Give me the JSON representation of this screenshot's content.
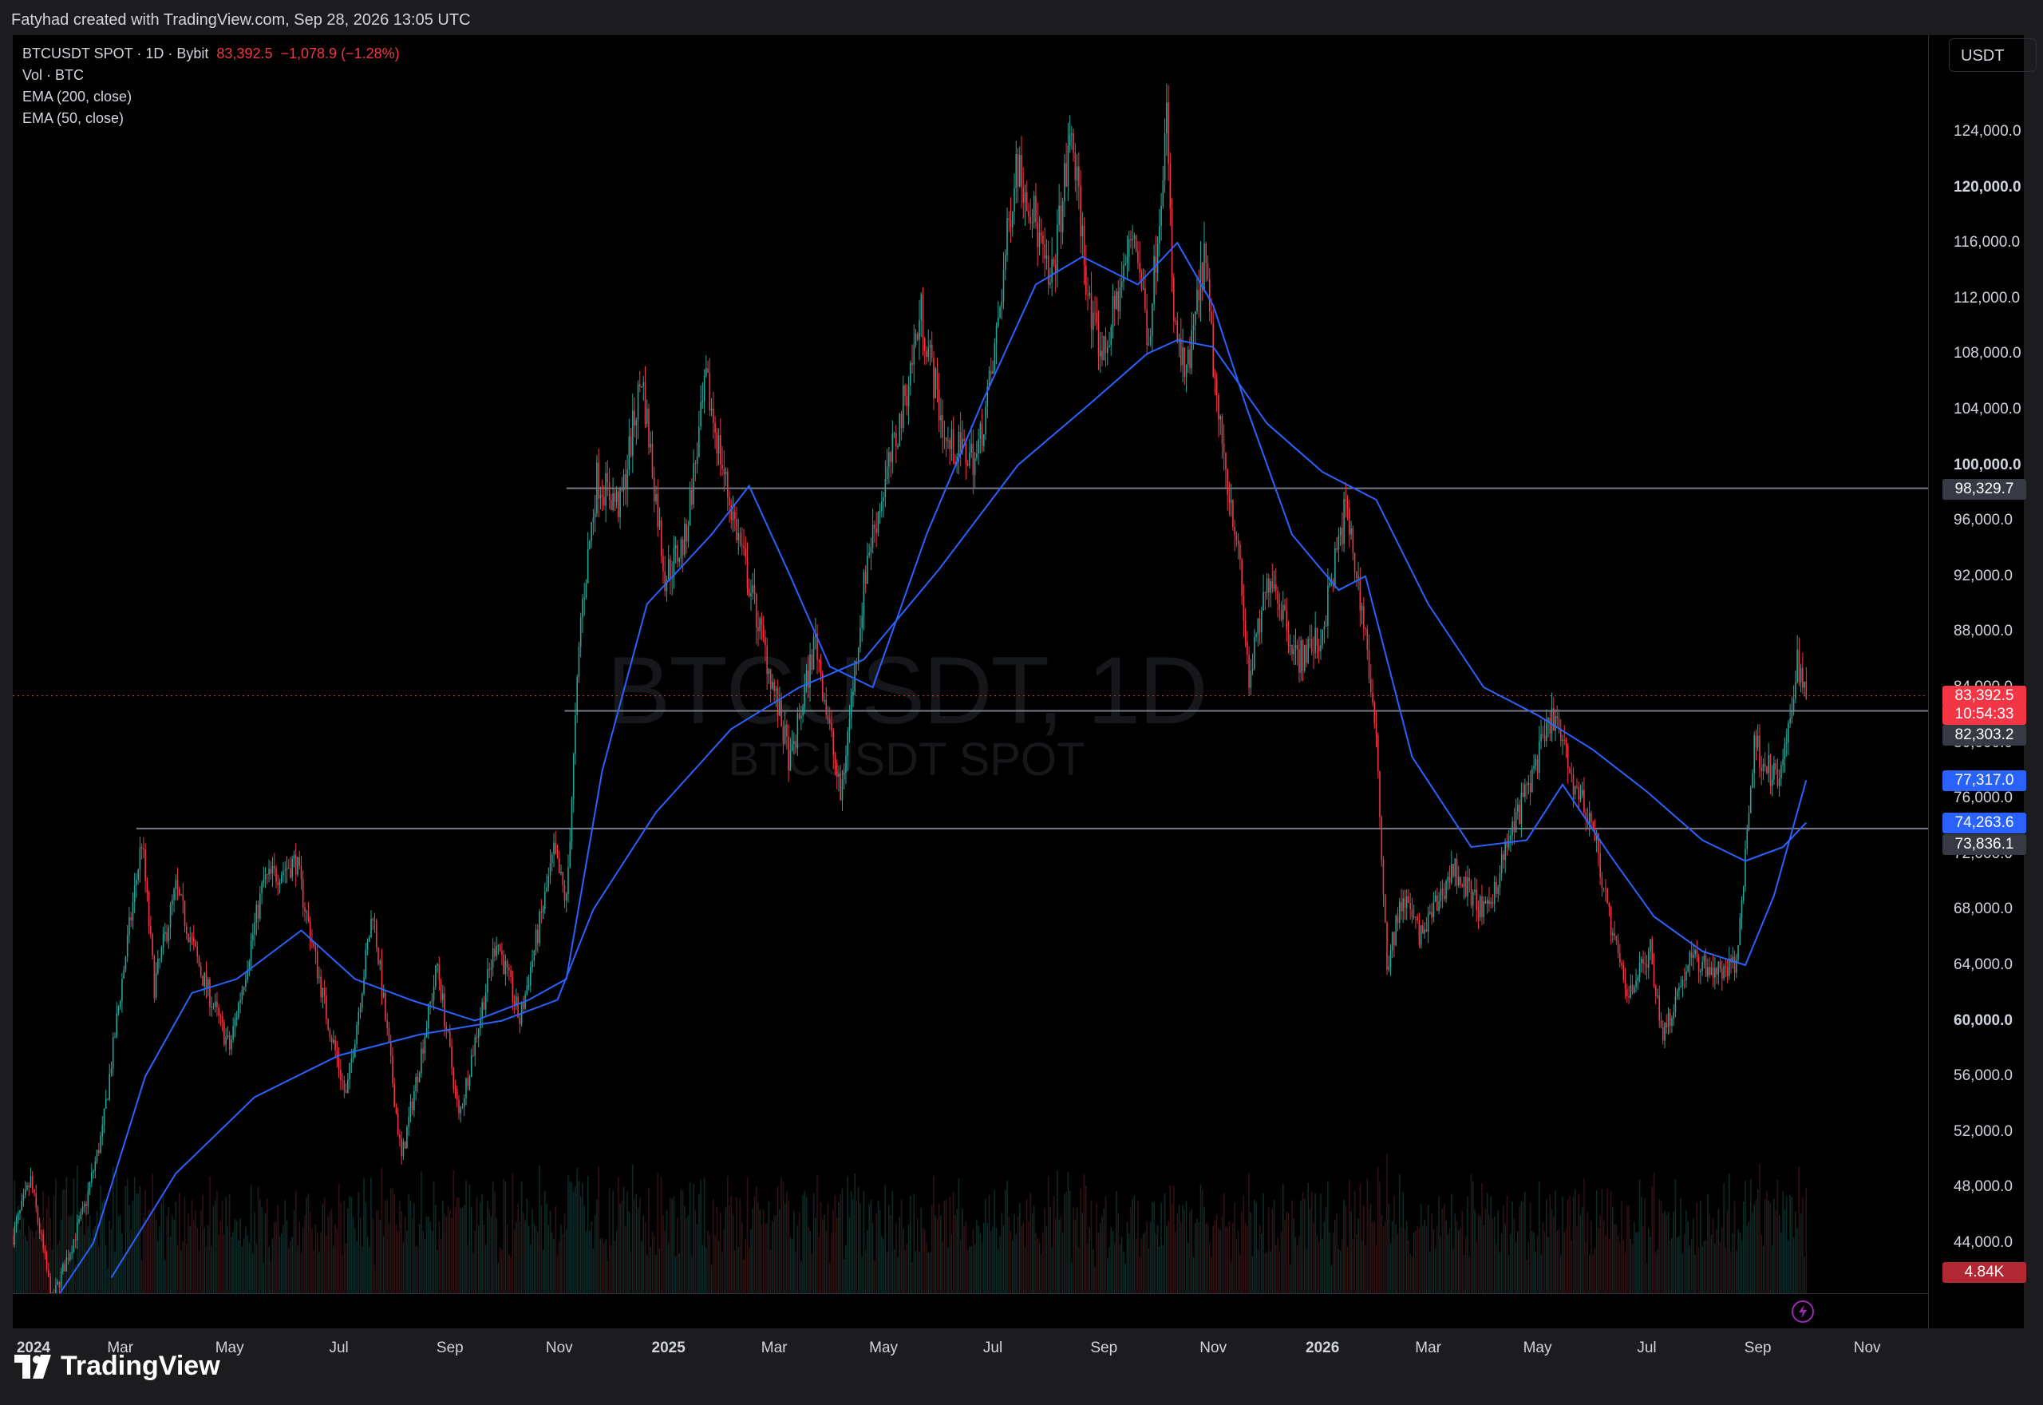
{
  "caption": "Fatyhad created with TradingView.com, Sep 28, 2026 13:05 UTC",
  "legend": {
    "symbol_line": "BTCUSDT SPOT · 1D · Bybit",
    "last": "83,392.5",
    "change": "−1,078.9 (−1.28%)",
    "vol": "Vol · BTC",
    "ema200": "EMA (200, close)",
    "ema50": "EMA (50, close)"
  },
  "unit_button": "USDT",
  "watermark": {
    "main": "BTCUSDT, 1D",
    "sub": "BTCUSDT SPOT"
  },
  "brand": "TradingView",
  "colors": {
    "up": "#26a69a",
    "down": "#f23645",
    "ema": "#2962ff",
    "hline": "#787b86",
    "last_price": "#f23645",
    "background": "#000000"
  },
  "price_labels": {
    "resistance": "98,329.7",
    "last_price": "83,392.5",
    "countdown": "10:54:33",
    "level_mid": "82,303.2",
    "ema50_value": "77,317.0",
    "ema200_value": "74,263.6",
    "level_low": "73,836.1",
    "volume_value": "4.84K"
  },
  "chart_data": {
    "type": "candlestick",
    "symbol": "BTCUSDT SPOT",
    "interval": "1D",
    "exchange": "Bybit",
    "y_axis": {
      "ticks": [
        "124,000.0",
        "120,000.0",
        "116,000.0",
        "112,000.0",
        "108,000.0",
        "104,000.0",
        "100,000.0",
        "96,000.0",
        "92,000.0",
        "88,000.0",
        "84,000.0",
        "80,000.0",
        "76,000.0",
        "72,000.0",
        "68,000.0",
        "64,000.0",
        "60,000.0",
        "56,000.0",
        "52,000.0",
        "48,000.0",
        "44,000.0"
      ],
      "ylim": [
        41500,
        130000
      ]
    },
    "x_axis": {
      "ticks": [
        "2024",
        "Mar",
        "May",
        "Jul",
        "Sep",
        "Nov",
        "2025",
        "Mar",
        "May",
        "Jul",
        "Sep",
        "Nov",
        "2026",
        "Mar",
        "May",
        "Jul",
        "Sep",
        "Nov"
      ]
    },
    "horizontal_lines": [
      98329.7,
      82303.2,
      73836.1
    ],
    "price_path": [
      [
        "2024-01-01",
        44500
      ],
      [
        "2024-01-11",
        48500
      ],
      [
        "2024-01-23",
        39800
      ],
      [
        "2024-02-10",
        46500
      ],
      [
        "2024-02-20",
        52000
      ],
      [
        "2024-03-01",
        62000
      ],
      [
        "2024-03-13",
        73000
      ],
      [
        "2024-03-20",
        62500
      ],
      [
        "2024-04-01",
        69500
      ],
      [
        "2024-04-15",
        63500
      ],
      [
        "2024-05-01",
        58000
      ],
      [
        "2024-05-20",
        70000
      ],
      [
        "2024-06-07",
        71500
      ],
      [
        "2024-06-24",
        60500
      ],
      [
        "2024-07-05",
        54500
      ],
      [
        "2024-07-20",
        68000
      ],
      [
        "2024-08-05",
        50000
      ],
      [
        "2024-08-25",
        64000
      ],
      [
        "2024-09-06",
        53000
      ],
      [
        "2024-09-27",
        66000
      ],
      [
        "2024-10-10",
        60000
      ],
      [
        "2024-10-29",
        72000
      ],
      [
        "2024-11-05",
        68500
      ],
      [
        "2024-11-13",
        89000
      ],
      [
        "2024-11-22",
        99000
      ],
      [
        "2024-12-05",
        97000
      ],
      [
        "2024-12-17",
        106500
      ],
      [
        "2024-12-30",
        92000
      ],
      [
        "2025-01-10",
        94500
      ],
      [
        "2025-01-22",
        106000
      ],
      [
        "2025-02-03",
        98000
      ],
      [
        "2025-02-25",
        86000
      ],
      [
        "2025-03-10",
        78500
      ],
      [
        "2025-03-24",
        87500
      ],
      [
        "2025-04-07",
        76000
      ],
      [
        "2025-04-22",
        93500
      ],
      [
        "2025-05-10",
        103000
      ],
      [
        "2025-05-22",
        111000
      ],
      [
        "2025-06-05",
        101500
      ],
      [
        "2025-06-22",
        100500
      ],
      [
        "2025-07-01",
        107000
      ],
      [
        "2025-07-14",
        122000
      ],
      [
        "2025-07-24",
        118000
      ],
      [
        "2025-08-02",
        112500
      ],
      [
        "2025-08-14",
        124000
      ],
      [
        "2025-08-25",
        110000
      ],
      [
        "2025-09-01",
        108000
      ],
      [
        "2025-09-18",
        117000
      ],
      [
        "2025-09-26",
        109000
      ],
      [
        "2025-10-06",
        125000
      ],
      [
        "2025-10-10",
        110000
      ],
      [
        "2025-10-17",
        106000
      ],
      [
        "2025-10-27",
        115000
      ],
      [
        "2025-11-04",
        103000
      ],
      [
        "2025-11-14",
        95000
      ],
      [
        "2025-11-21",
        84500
      ],
      [
        "2025-12-03",
        92500
      ],
      [
        "2025-12-18",
        86000
      ],
      [
        "2025-12-31",
        87500
      ],
      [
        "2026-01-14",
        97000
      ],
      [
        "2026-01-25",
        88000
      ],
      [
        "2026-02-01",
        78000
      ],
      [
        "2026-02-06",
        64000
      ],
      [
        "2026-02-15",
        69000
      ],
      [
        "2026-02-25",
        66000
      ],
      [
        "2026-03-15",
        71000
      ],
      [
        "2026-04-02",
        67500
      ],
      [
        "2026-04-15",
        73000
      ],
      [
        "2026-04-30",
        78500
      ],
      [
        "2026-05-10",
        82000
      ],
      [
        "2026-05-20",
        77500
      ],
      [
        "2026-06-01",
        74000
      ],
      [
        "2026-06-12",
        66000
      ],
      [
        "2026-06-20",
        62000
      ],
      [
        "2026-07-03",
        65000
      ],
      [
        "2026-07-10",
        59000
      ],
      [
        "2026-07-25",
        64500
      ],
      [
        "2026-08-10",
        63500
      ],
      [
        "2026-08-20",
        64000
      ],
      [
        "2026-08-30",
        80000
      ],
      [
        "2026-09-12",
        77000
      ],
      [
        "2026-09-18",
        80500
      ],
      [
        "2026-09-23",
        86000
      ],
      [
        "2026-09-28",
        83392.5
      ]
    ],
    "ema200_path": [
      [
        "2024-02-25",
        41500
      ],
      [
        "2024-04-01",
        49000
      ],
      [
        "2024-05-15",
        54500
      ],
      [
        "2024-07-01",
        57500
      ],
      [
        "2024-08-15",
        59000
      ],
      [
        "2024-09-30",
        60000
      ],
      [
        "2024-10-31",
        61500
      ],
      [
        "2024-11-20",
        68000
      ],
      [
        "2024-12-25",
        75000
      ],
      [
        "2025-02-05",
        81000
      ],
      [
        "2025-03-15",
        84000
      ],
      [
        "2025-04-20",
        86000
      ],
      [
        "2025-06-01",
        92500
      ],
      [
        "2025-07-15",
        100000
      ],
      [
        "2025-08-25",
        104500
      ],
      [
        "2025-09-25",
        108000
      ],
      [
        "2025-10-12",
        109000
      ],
      [
        "2025-11-01",
        108500
      ],
      [
        "2025-12-01",
        103000
      ],
      [
        "2026-01-01",
        99500
      ],
      [
        "2026-01-31",
        97500
      ],
      [
        "2026-03-01",
        90000
      ],
      [
        "2026-04-01",
        84000
      ],
      [
        "2026-05-01",
        82000
      ],
      [
        "2026-06-01",
        79500
      ],
      [
        "2026-07-01",
        76500
      ],
      [
        "2026-08-01",
        73000
      ],
      [
        "2026-08-25",
        71500
      ],
      [
        "2026-09-15",
        72500
      ],
      [
        "2026-09-28",
        74263.6
      ]
    ],
    "ema50_path": [
      [
        "2024-01-15",
        38000
      ],
      [
        "2024-02-15",
        44000
      ],
      [
        "2024-03-15",
        56000
      ],
      [
        "2024-04-10",
        62000
      ],
      [
        "2024-05-05",
        63000
      ],
      [
        "2024-06-10",
        66500
      ],
      [
        "2024-07-10",
        63000
      ],
      [
        "2024-08-10",
        61500
      ],
      [
        "2024-09-15",
        60000
      ],
      [
        "2024-10-15",
        61500
      ],
      [
        "2024-11-05",
        63000
      ],
      [
        "2024-11-25",
        78000
      ],
      [
        "2024-12-20",
        90000
      ],
      [
        "2025-01-25",
        95000
      ],
      [
        "2025-02-15",
        98500
      ],
      [
        "2025-03-10",
        92000
      ],
      [
        "2025-04-01",
        85500
      ],
      [
        "2025-04-25",
        84000
      ],
      [
        "2025-05-25",
        95000
      ],
      [
        "2025-06-25",
        104500
      ],
      [
        "2025-07-25",
        113000
      ],
      [
        "2025-08-20",
        115000
      ],
      [
        "2025-09-20",
        113000
      ],
      [
        "2025-10-12",
        116000
      ],
      [
        "2025-11-01",
        111500
      ],
      [
        "2025-11-20",
        104000
      ],
      [
        "2025-12-15",
        95000
      ],
      [
        "2026-01-10",
        91000
      ],
      [
        "2026-01-25",
        92000
      ],
      [
        "2026-02-20",
        79000
      ],
      [
        "2026-03-25",
        72500
      ],
      [
        "2026-04-25",
        73000
      ],
      [
        "2026-05-15",
        77000
      ],
      [
        "2026-06-10",
        72000
      ],
      [
        "2026-07-05",
        67500
      ],
      [
        "2026-08-01",
        65000
      ],
      [
        "2026-08-25",
        64000
      ],
      [
        "2026-09-10",
        69000
      ],
      [
        "2026-09-28",
        77317.0
      ]
    ],
    "volume_max": 4840
  }
}
